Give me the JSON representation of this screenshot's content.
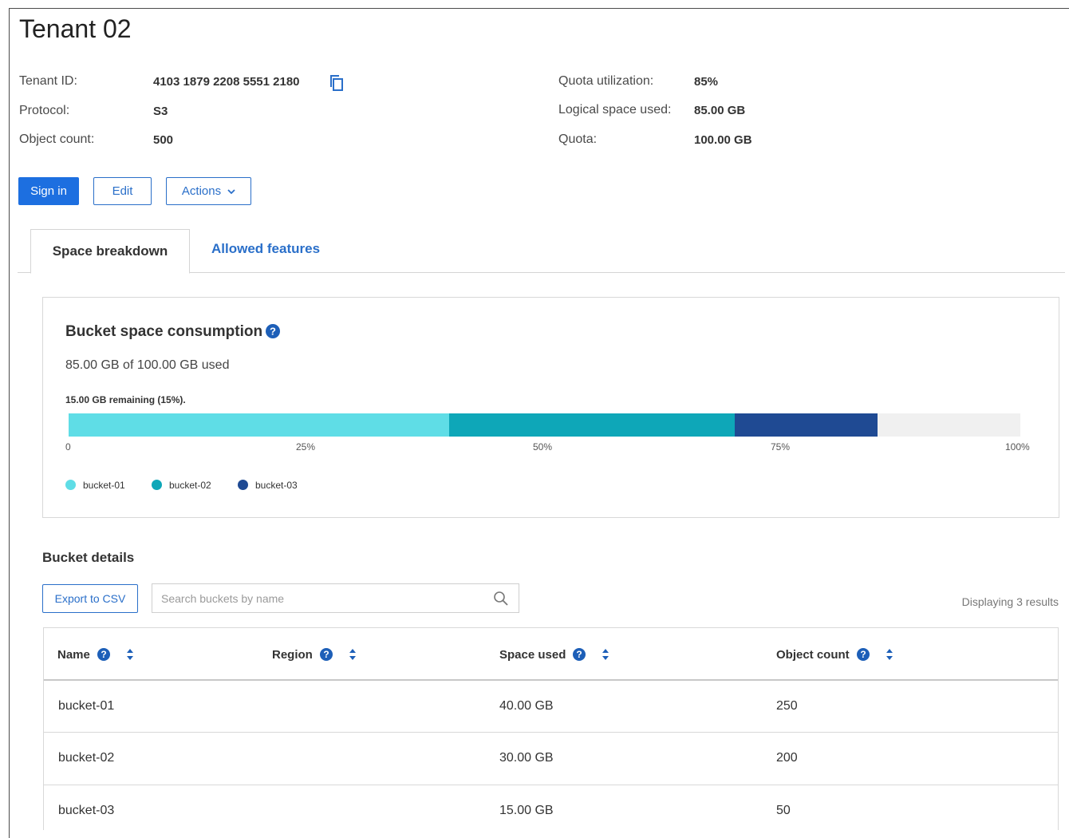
{
  "page": {
    "title": "Tenant 02"
  },
  "details_left": [
    {
      "label": "Tenant ID:",
      "value": "4103 1879 2208 5551 2180"
    },
    {
      "label": "Protocol:",
      "value": "S3"
    },
    {
      "label": "Object count:",
      "value": "500"
    }
  ],
  "details_right": [
    {
      "label": "Quota utilization:",
      "value": "85%"
    },
    {
      "label": "Logical space used:",
      "value": "85.00 GB"
    },
    {
      "label": "Quota:",
      "value": "100.00 GB"
    }
  ],
  "buttons": {
    "sign_in": "Sign in",
    "edit": "Edit",
    "actions": "Actions"
  },
  "tabs": [
    {
      "label": "Space breakdown",
      "active": true
    },
    {
      "label": "Allowed features",
      "active": false
    }
  ],
  "consumption": {
    "title": "Bucket space consumption",
    "used_text": "85.00 GB of 100.00 GB used",
    "remaining_text": "15.00 GB remaining (15%).",
    "ticks": [
      "0",
      "25%",
      "50%",
      "75%",
      "100%"
    ],
    "segments": [
      {
        "name": "bucket-01",
        "percent": 40,
        "color": "#5fdde6"
      },
      {
        "name": "bucket-02",
        "percent": 30,
        "color": "#0ea7b8"
      },
      {
        "name": "bucket-03",
        "percent": 15,
        "color": "#1f4a93"
      }
    ],
    "empty_color": "#f0f0f0"
  },
  "bucket_details": {
    "title": "Bucket details",
    "export_label": "Export to CSV",
    "search_placeholder": "Search buckets by name",
    "results_text": "Displaying 3 results",
    "columns": [
      "Name",
      "Region",
      "Space used",
      "Object count"
    ],
    "rows": [
      {
        "name": "bucket-01",
        "region": "",
        "space_used": "40.00 GB",
        "object_count": "250"
      },
      {
        "name": "bucket-02",
        "region": "",
        "space_used": "30.00 GB",
        "object_count": "200"
      },
      {
        "name": "bucket-03",
        "region": "",
        "space_used": "15.00 GB",
        "object_count": "50"
      }
    ]
  },
  "colors": {
    "primary": "#1d6fe0",
    "link": "#2a6fc9",
    "help_icon": "#1d5fb8"
  },
  "icons": {
    "copy": "copy-icon",
    "help": "help-icon",
    "sort": "sort-icon",
    "search": "search-icon",
    "chevron": "chevron-down-icon"
  }
}
